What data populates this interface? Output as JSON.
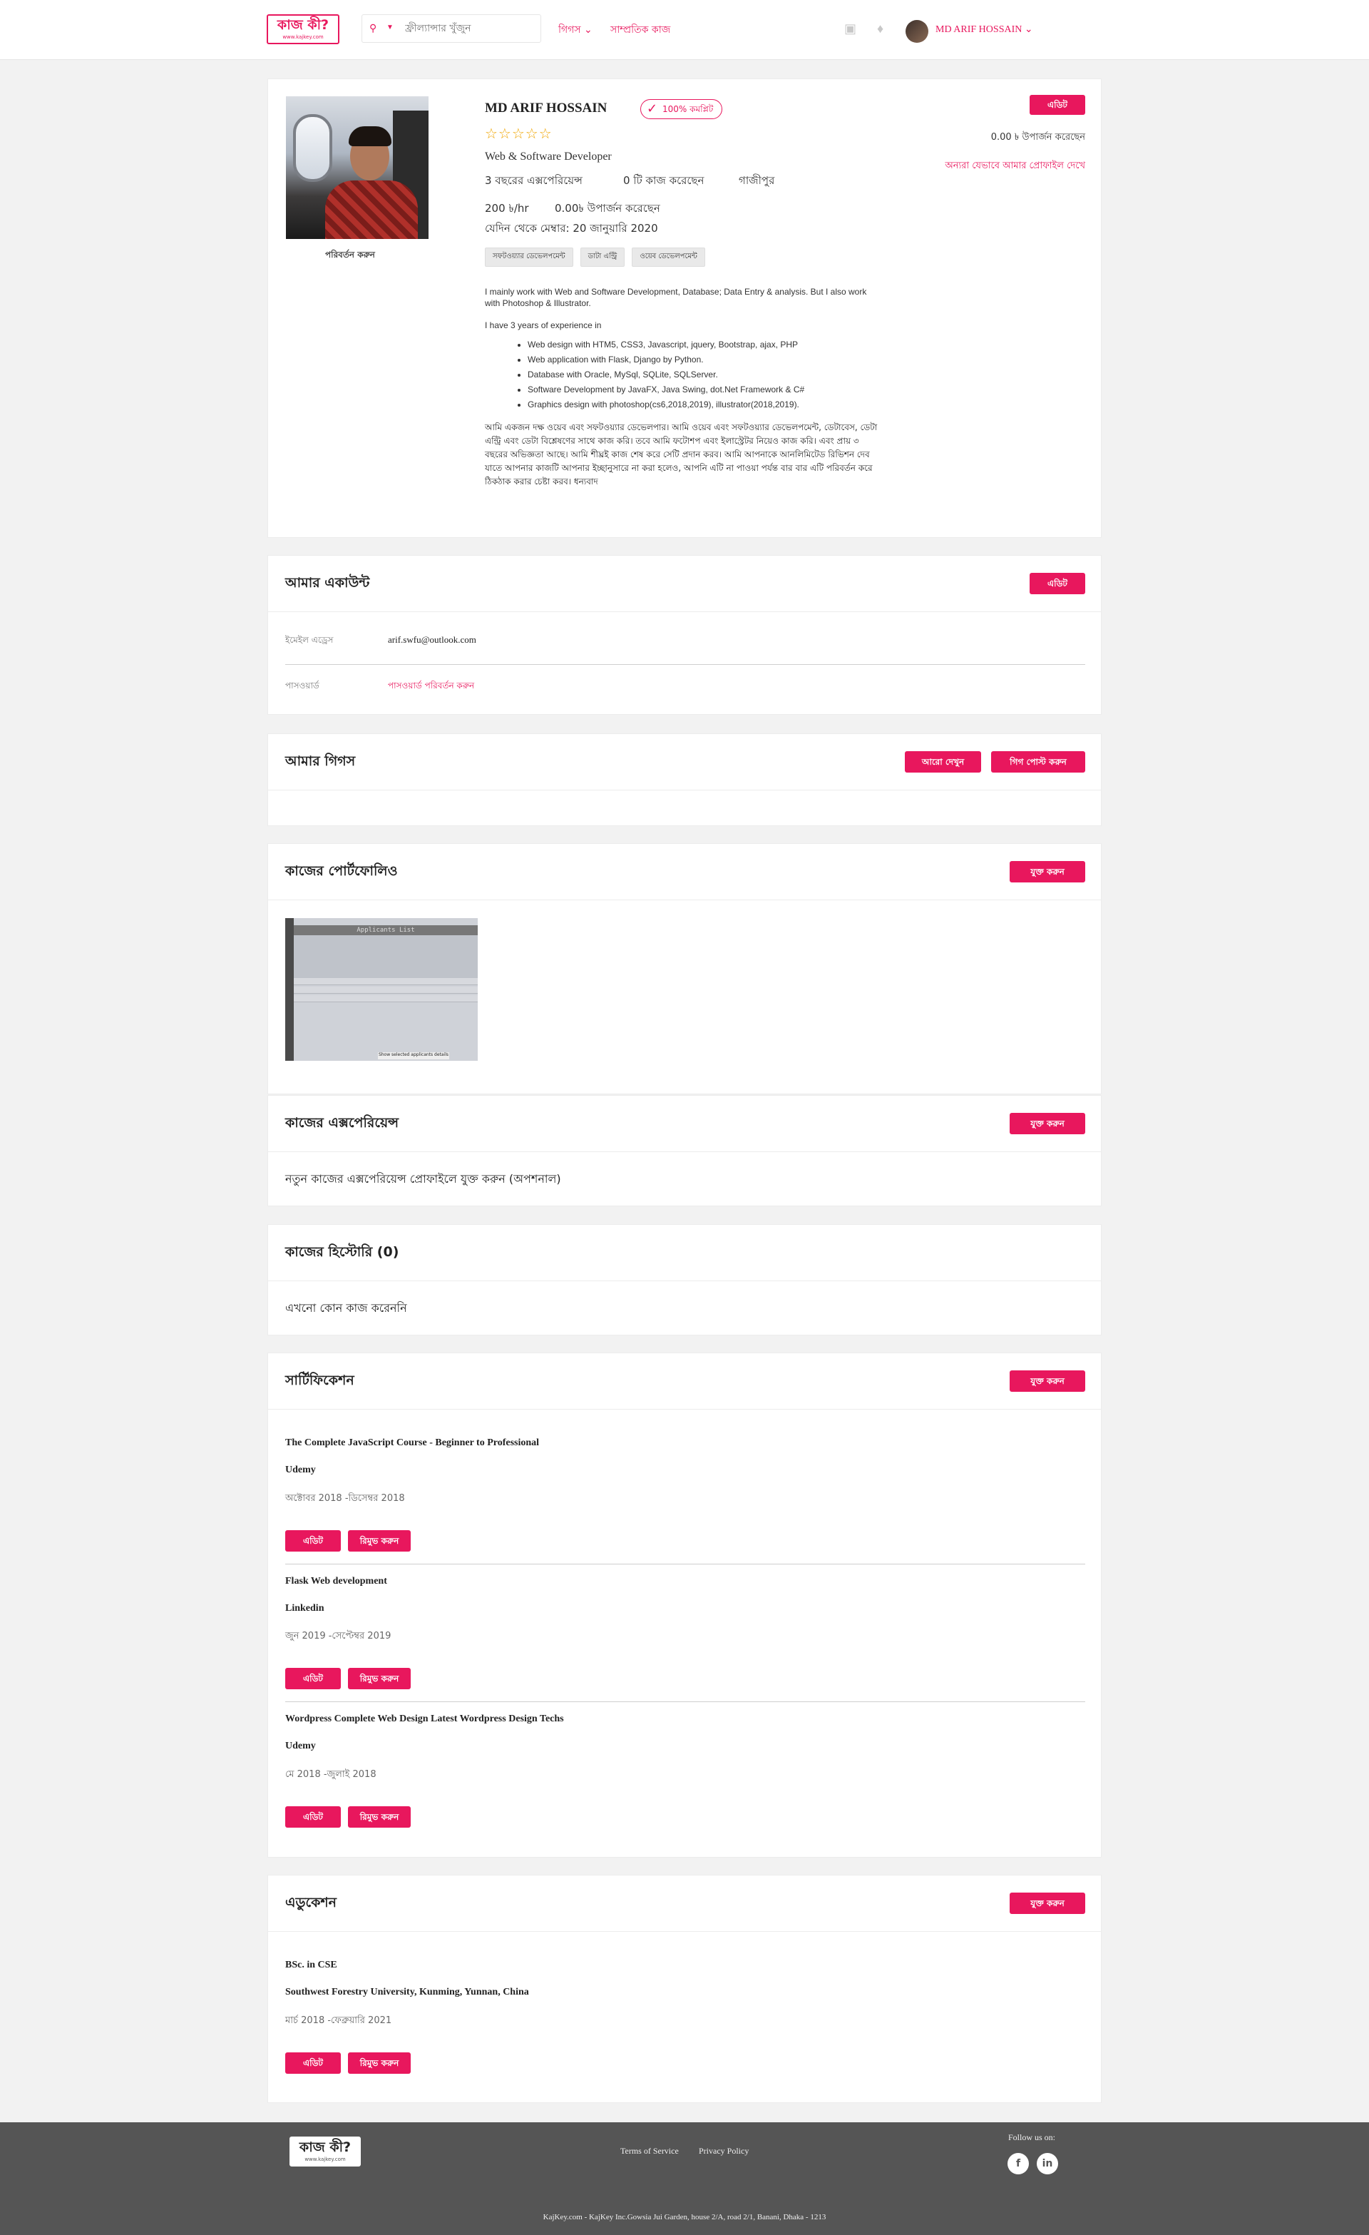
{
  "header": {
    "logo_text": "কাজ কী?",
    "logo_sub": "www.kajkey.com",
    "search_placeholder": "ফ্রীল্যান্সার খুঁজুন",
    "nav_gigs": "গিগস ⌄",
    "nav_recent_jobs": "সাম্প্রতিক কাজ",
    "user_name": "MD ARIF HOSSAIN ⌄"
  },
  "profile": {
    "name": "MD ARIF HOSSAIN",
    "complete_badge": "100% কমপ্লিট",
    "rating_stars": "☆☆☆☆☆",
    "title": "Web & Software Developer",
    "experience": "3 বছরের এক্সপেরিয়েন্স",
    "jobs_done": "0 টি কাজ করেছেন",
    "location": "গাজীপুর",
    "rate": "200 ৳/hr",
    "earned": "0.00৳ উপার্জন করেছেন",
    "member_since": "যেদিন থেকে মেম্বার: 20 জানুয়ারি 2020",
    "change_photo": "পরিবর্তন করুন",
    "tags": [
      "সফটওয়্যার ডেভেলপমেন্ট",
      "ডাটা এন্ট্রি",
      "ওয়েব ডেভেলপমেন্ট"
    ],
    "edit_label": "এডিট",
    "earned_right": "0.00 ৳ উপার্জন করেছেন",
    "view_as_others": "অন্যরা যেভাবে আমার প্রোফাইল দেখে",
    "about_p1": "I mainly work with Web and Software Development, Database; Data Entry & analysis. But I also work with Photoshop & Illustrator.",
    "about_p2": "I have 3 years of experience in",
    "about_list": [
      "Web design with HTM5, CSS3, Javascript, jquery, Bootstrap, ajax, PHP",
      "Web application with Flask, Django by Python.",
      "Database with Oracle, MySql, SQLite, SQLServer.",
      "Software Development by JavaFX, Java Swing, dot.Net Framework & C#",
      "Graphics design with photoshop(cs6,2018,2019), illustrator(2018,2019)."
    ],
    "about_bn": "আমি একজন দক্ষ ওয়েব এবং সফটওয়্যার ডেভেলপার। আমি ওয়েব এবং সফটওয়্যার ডেভেলপমেন্ট, ডেটাবেস, ডেটা এন্ট্রি এবং ডেটা বিশ্লেষণের সাথে কাজ করি। তবে আমি ফটোশপ এবং ইলাস্ট্রেটর নিয়েও কাজ করি। এবং প্রায় ৩ বছরের অভিজ্ঞতা আছে। আমি শীঘ্রই কাজ শেষ করে সেটি প্রদান করব। আমি আপনাকে আনলিমিটেড রিভিশন দেব যাতে আপনার কাজটি আপনার ইচ্ছানুসারে না করা হলেও, আপনি এটি না পাওয়া পর্যন্ত বার বার এটি পরিবর্তন করে ঠিকঠাক করার চেষ্টা করব। ধন্যবাদ"
  },
  "account": {
    "title": "আমার একাউন্ট",
    "edit_label": "এডিট",
    "email_label": "ইমেইল এড্রেস",
    "email_value": "arif.swfu@outlook.com",
    "password_label": "পাসওয়ার্ড",
    "password_link": "পাসওয়ার্ড পরিবর্তন করুন"
  },
  "gigs": {
    "title": "আমার গিগস",
    "see_more": "আরো দেখুন",
    "post_gig": "গিগ পোস্ট করুন"
  },
  "portfolio": {
    "title": "কাজের পোর্টফোলিও",
    "add_label": "যুক্ত করুন",
    "thumb_title": "Applicants List",
    "thumb_footer": "Show selected applicants details"
  },
  "experience": {
    "title": "কাজের এক্সপেরিয়েন্স",
    "add_label": "যুক্ত করুন",
    "empty_text": "নতুন কাজের এক্সপেরিয়েন্স প্রোফাইলে যুক্ত করুন (অপশনাল)"
  },
  "history": {
    "title": "কাজের হিস্টোরি (0)",
    "empty_text": "এখনো কোন কাজ করেননি"
  },
  "certification": {
    "title": "সার্টিফিকেশন",
    "add_label": "যুক্ত করুন",
    "edit_label": "এডিট",
    "remove_label": "রিমুভ করুন",
    "items": [
      {
        "name": "The Complete JavaScript Course - Beginner to Professional",
        "org": "Udemy",
        "dates": "অক্টোবর 2018 -ডিসেম্বর 2018"
      },
      {
        "name": "Flask Web development",
        "org": "Linkedin",
        "dates": "জুন 2019 -সেপ্টেম্বর 2019"
      },
      {
        "name": "Wordpress Complete Web Design Latest Wordpress Design Techs",
        "org": "Udemy",
        "dates": "মে 2018 -জুলাই 2018"
      }
    ]
  },
  "education": {
    "title": "এডুকেশন",
    "add_label": "যুক্ত করুন",
    "edit_label": "এডিট",
    "remove_label": "রিমুভ করুন",
    "degree": "BSc. in CSE",
    "school": "Southwest Forestry University, Kunming, Yunnan, China",
    "dates": "মার্চ 2018 -ফেব্রুয়ারি 2021"
  },
  "footer": {
    "terms": "Terms of Service",
    "privacy": "Privacy Policy",
    "follow": "Follow us on:",
    "facebook": "f",
    "linkedin": "in",
    "copyright": "KajKey.com - KajKey Inc.Gowsia Jui Garden, house 2/A, road 2/1, Banani, Dhaka - 1213"
  },
  "colors": {
    "accent": "#e8175d",
    "footer_bg": "#555555",
    "page_bg": "#f2f2f2"
  }
}
